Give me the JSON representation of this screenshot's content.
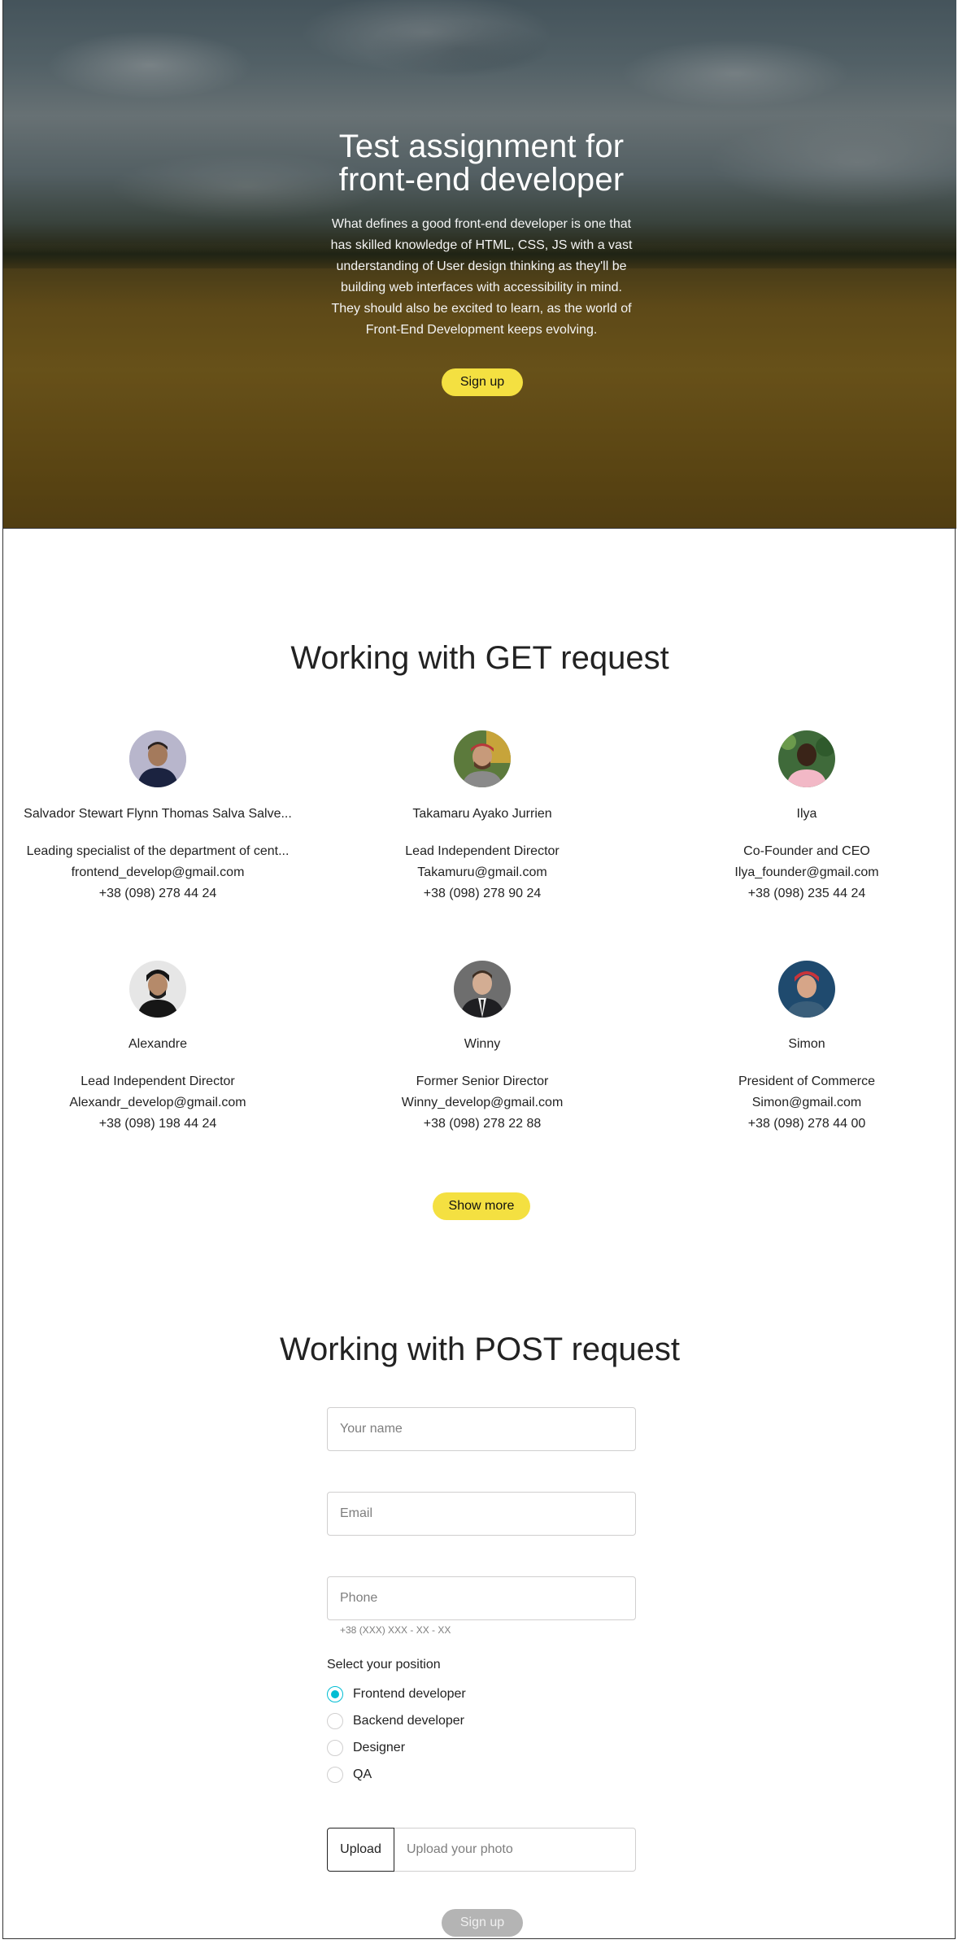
{
  "hero": {
    "title_line1": "Test assignment for",
    "title_line2": "front-end developer",
    "description": "What defines a good front-end developer is one that has skilled knowledge of HTML, CSS, JS with a vast understanding of User design thinking as they'll be building web interfaces with accessibility in mind. They should also be excited to learn, as the world of Front-End Development keeps evolving.",
    "button_label": "Sign up"
  },
  "get_section": {
    "title": "Working with GET request",
    "users": [
      {
        "name": "Salvador Stewart Flynn Thomas Salva Salve...",
        "position": "Leading specialist of the department of cent...",
        "email": "frontend_develop@gmail.com",
        "phone": "+38 (098) 278 44 24"
      },
      {
        "name": "Takamaru Ayako Jurrien",
        "position": "Lead Independent Director",
        "email": "Takamuru@gmail.com",
        "phone": "+38 (098) 278 90 24"
      },
      {
        "name": "Ilya",
        "position": "Co-Founder and CEO",
        "email": "Ilya_founder@gmail.com",
        "phone": "+38 (098) 235 44 24"
      },
      {
        "name": "Alexandre",
        "position": "Lead Independent Director",
        "email": "Alexandr_develop@gmail.com",
        "phone": "+38 (098) 198 44 24"
      },
      {
        "name": "Winny",
        "position": "Former Senior Director",
        "email": "Winny_develop@gmail.com",
        "phone": "+38 (098) 278 22 88"
      },
      {
        "name": "Simon",
        "position": "President of Commerce",
        "email": "Simon@gmail.com",
        "phone": "+38 (098) 278 44 00"
      }
    ],
    "show_more_label": "Show more"
  },
  "post_section": {
    "title": "Working with POST request",
    "name_placeholder": "Your name",
    "email_placeholder": "Email",
    "phone_placeholder": "Phone",
    "phone_helper": "+38 (XXX) XXX - XX - XX",
    "position_heading": "Select your position",
    "positions": [
      {
        "label": "Frontend developer",
        "checked": true
      },
      {
        "label": "Backend developer",
        "checked": false
      },
      {
        "label": "Designer",
        "checked": false
      },
      {
        "label": "QA",
        "checked": false
      }
    ],
    "upload_button": "Upload",
    "upload_placeholder": "Upload your photo",
    "submit_label": "Sign up"
  },
  "colors": {
    "primary_yellow": "#f4e041",
    "radio_accent": "#00bdd3",
    "disabled_gray": "#b4b4b4"
  }
}
